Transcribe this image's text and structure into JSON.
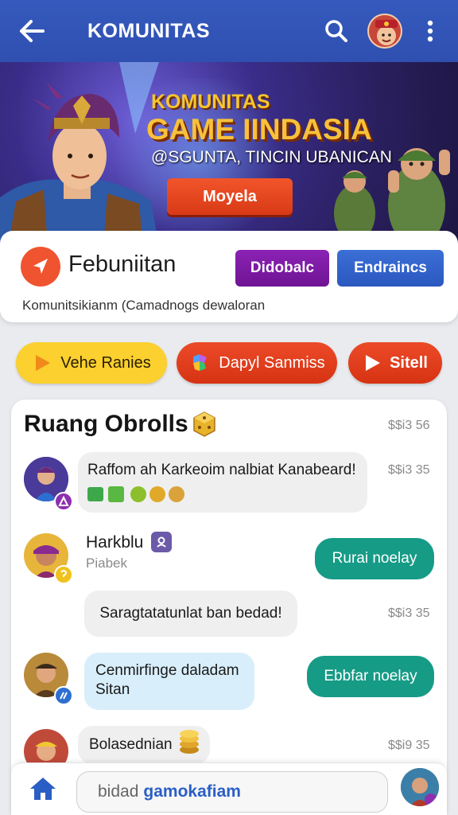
{
  "app_bar": {
    "title": "KOMUNITAS"
  },
  "banner": {
    "title_line1": "KOMUNITAS",
    "title_line2": "GAME IINDASIA",
    "subtitle": "@SGUNTA, TINCIN UBANICAN",
    "cta_label": "Moyela"
  },
  "community": {
    "name": "Febuniitan",
    "button_primary": "Didobalc",
    "button_secondary": "Endraincs",
    "description": "Komunitsikianm (Camadnogs dewaloran"
  },
  "chips": [
    {
      "label": "Vehe Ranies"
    },
    {
      "label": "Dapyl Sanmiss"
    },
    {
      "label": "Sitell"
    }
  ],
  "chat": {
    "title": "Ruang Obrolls",
    "title_time": "$$i3 56",
    "messages": [
      {
        "text": "Raffom ah Karkeoim nalbiat Kanabeard!",
        "time": "$$i3 35"
      },
      {
        "author": "Harkblu",
        "subtitle": "Piabek",
        "reply": "Rurai noelay"
      },
      {
        "text": "Saragtatatunlat ban bedad!",
        "time": "$$i3 35"
      },
      {
        "text_line1": "Cenmirfinge daladam",
        "text_line2": "Sitan",
        "reply": "Ebbfar noelay"
      },
      {
        "text": "Bolasednian",
        "time": "$$i9 35"
      }
    ]
  },
  "composer": {
    "prefix": "bidad",
    "highlight": "gamokafiam"
  },
  "colors": {
    "app_bar": "#3357ba",
    "accent_orange": "#e8441f",
    "teal": "#169b86",
    "purple": "#7c1ca5",
    "blue": "#3366cc"
  }
}
